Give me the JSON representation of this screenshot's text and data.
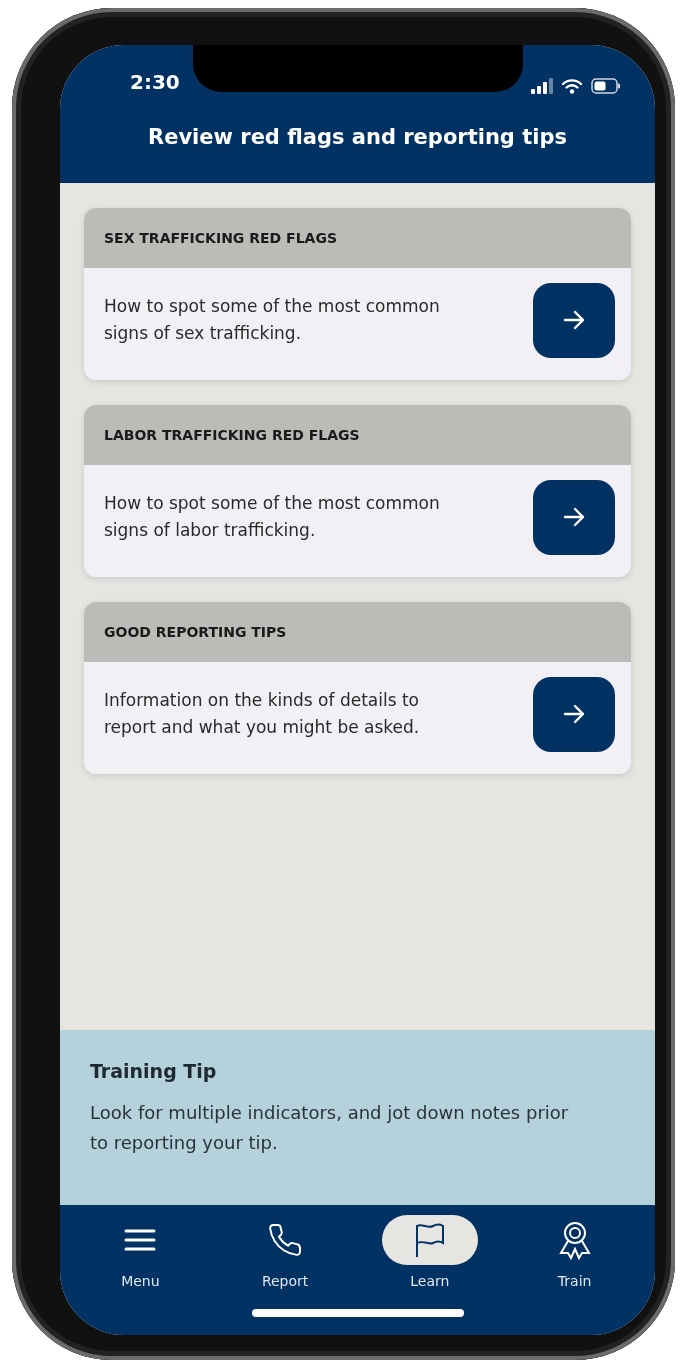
{
  "status_bar": {
    "time": "2:30"
  },
  "header": {
    "title": "Review red flags and reporting tips"
  },
  "cards": [
    {
      "title": "SEX TRAFFICKING RED FLAGS",
      "description": "How to spot some of the most common signs of sex trafficking."
    },
    {
      "title": "LABOR TRAFFICKING RED FLAGS",
      "description": "How to spot some of the most common signs of labor trafficking."
    },
    {
      "title": "GOOD REPORTING TIPS",
      "description": "Information on the kinds of details to report and what you might be asked."
    }
  ],
  "training_tip": {
    "title": "Training Tip",
    "text": "Look for multiple indicators, and jot down notes prior to reporting your tip."
  },
  "tab_bar": [
    {
      "label": "Menu",
      "kind": "menu",
      "selected": false
    },
    {
      "label": "Report",
      "kind": "phone",
      "selected": false
    },
    {
      "label": "Learn",
      "kind": "flag",
      "selected": true
    },
    {
      "label": "Train",
      "kind": "award",
      "selected": false
    }
  ]
}
